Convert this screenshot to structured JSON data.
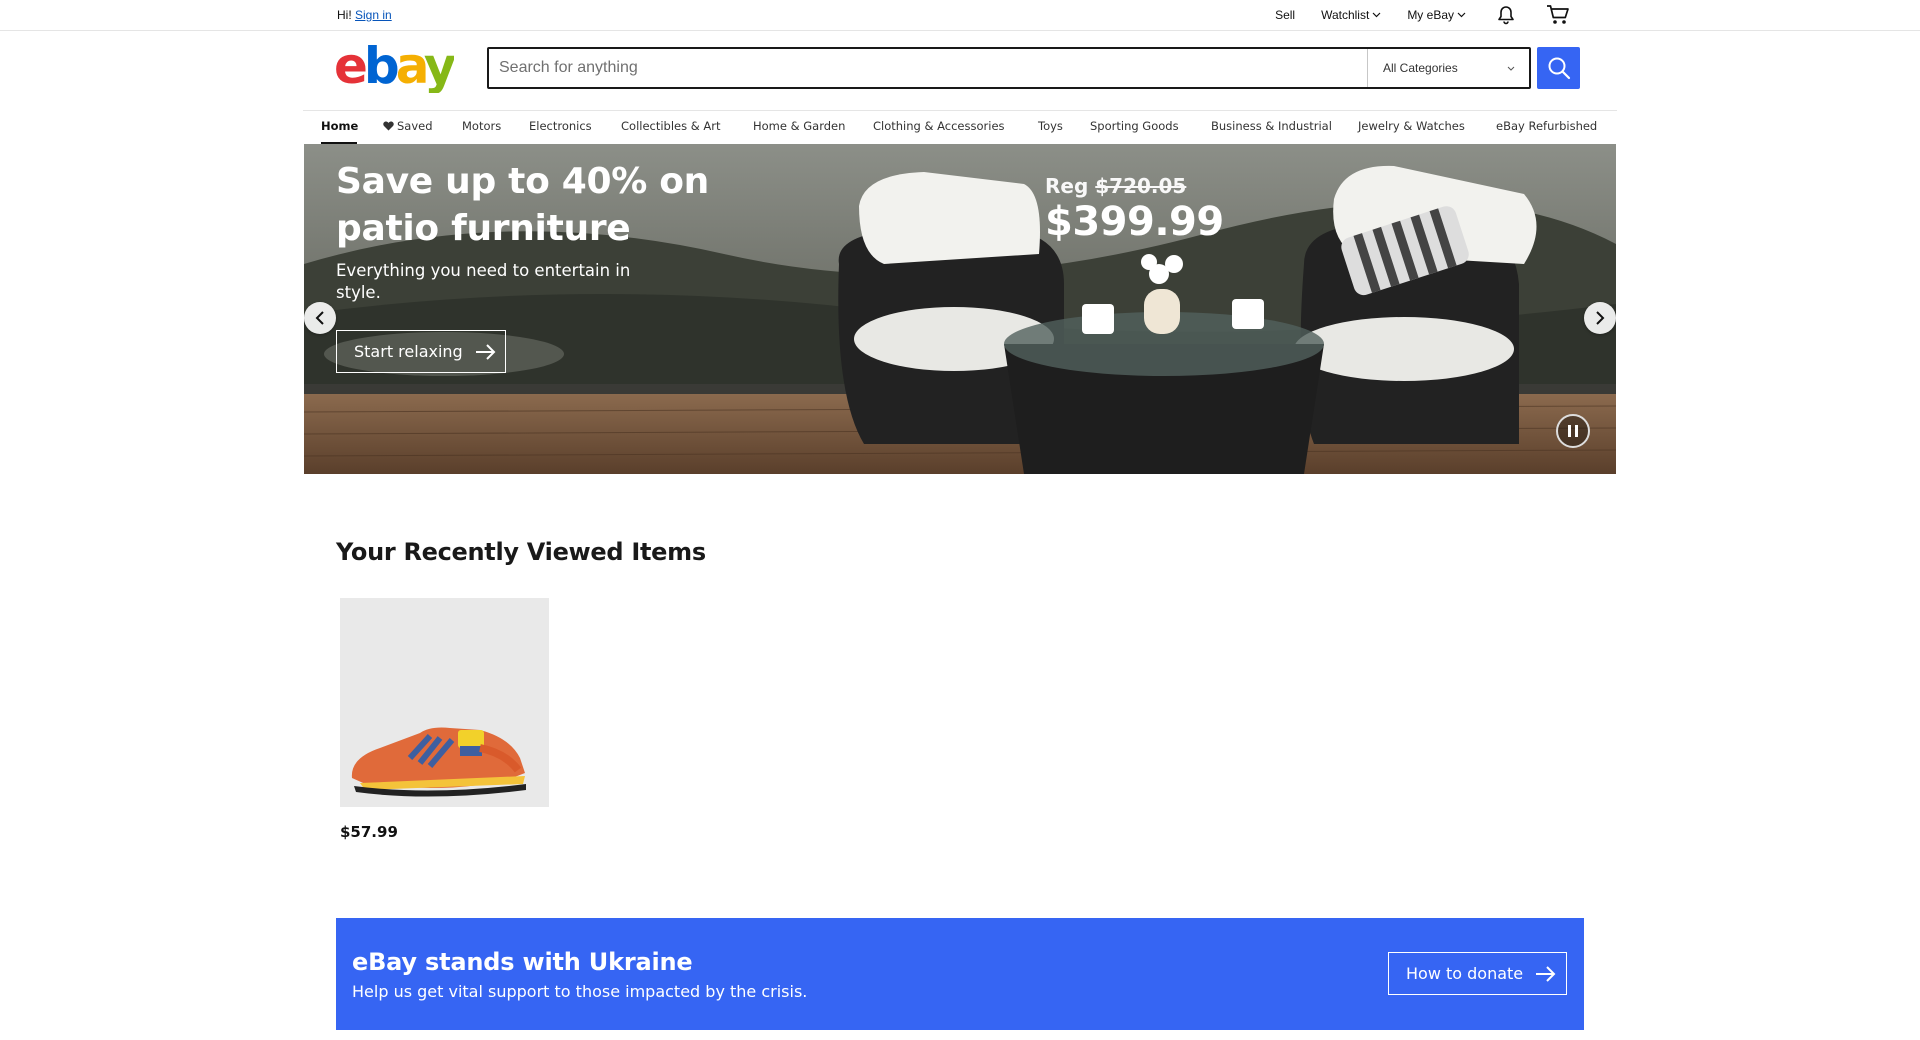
{
  "topbar": {
    "greeting": "Hi!",
    "signin": "Sign in",
    "sell": "Sell",
    "watchlist": "Watchlist",
    "myebay": "My eBay"
  },
  "header": {
    "logo_text": "ebay",
    "search_placeholder": "Search for anything",
    "category": "All Categories"
  },
  "nav": {
    "items": [
      "Home",
      "Saved",
      "Motors",
      "Electronics",
      "Collectibles & Art",
      "Home & Garden",
      "Clothing & Accessories",
      "Toys",
      "Sporting Goods",
      "Business & Industrial",
      "Jewelry & Watches",
      "eBay Refurbished"
    ]
  },
  "hero": {
    "title": "Save up to 40% on patio furniture",
    "subtitle": "Everything you need to entertain in style.",
    "cta": "Start relaxing",
    "reg_label": "Reg",
    "reg_price": "$720.05",
    "price": "$399.99"
  },
  "recently_viewed": {
    "title": "Your Recently Viewed Items",
    "items": [
      {
        "price": "$57.99"
      }
    ]
  },
  "ukraine": {
    "title": "eBay stands with Ukraine",
    "text": "Help us get vital support to those impacted by the crisis.",
    "button": "How to donate"
  },
  "colors": {
    "accent": "#3665f3",
    "logo_e": "#e53238",
    "logo_b": "#0064d2",
    "logo_a": "#f5af02",
    "logo_y": "#86b817"
  }
}
